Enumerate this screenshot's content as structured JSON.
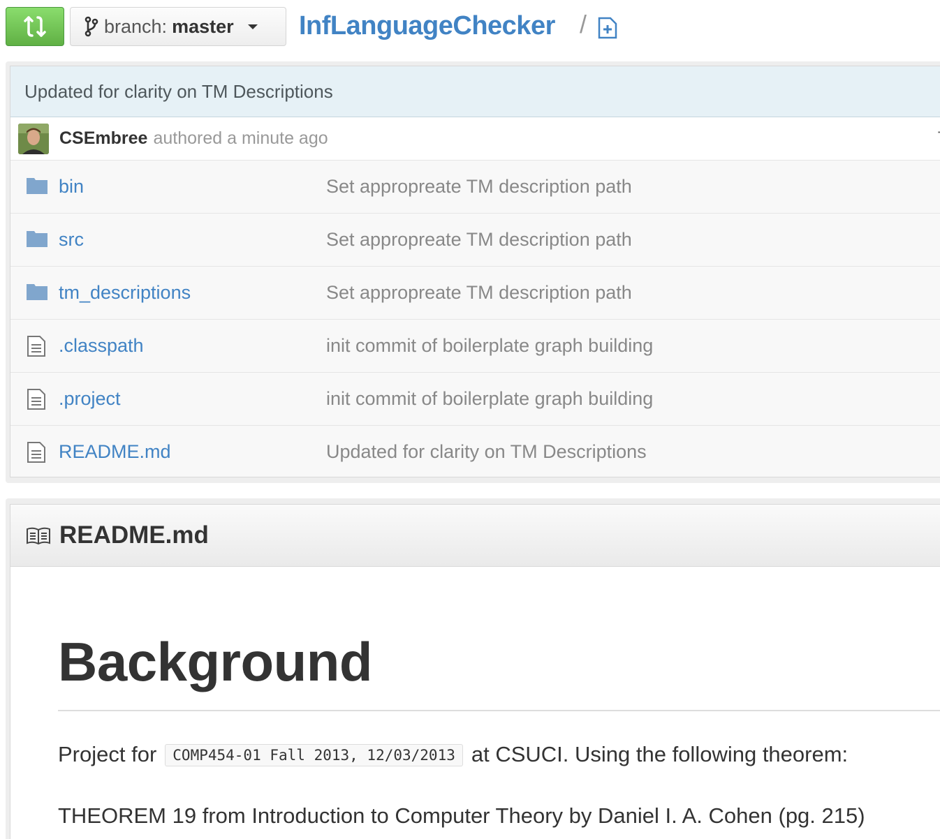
{
  "topbar": {
    "compare_icon": "compare-arrows-icon",
    "branch_label": "branch:",
    "branch_name": "master",
    "repo_name": "InfLanguageChecker",
    "path_separator": "/"
  },
  "latest_commit": {
    "message": "Updated for clarity on TM Descriptions",
    "author": "CSEmbree",
    "time_text": "authored a minute ago",
    "sha_fragment": "T"
  },
  "files": [
    {
      "type": "folder",
      "name": "bin",
      "message": "Set appropreate TM description path"
    },
    {
      "type": "folder",
      "name": "src",
      "message": "Set appropreate TM description path"
    },
    {
      "type": "folder",
      "name": "tm_descriptions",
      "message": "Set appropreate TM description path"
    },
    {
      "type": "file",
      "name": ".classpath",
      "message": "init commit of boilerplate graph building"
    },
    {
      "type": "file",
      "name": ".project",
      "message": "init commit of boilerplate graph building"
    },
    {
      "type": "file",
      "name": "README.md",
      "message": "Updated for clarity on TM Descriptions"
    }
  ],
  "readme": {
    "filename": "README.md",
    "heading": "Background",
    "p1_before": "Project for",
    "p1_code": "COMP454-01 Fall 2013, 12/03/2013",
    "p1_after": "at CSUCI. Using the following theorem:",
    "p2": "THEOREM 19 from Introduction to Computer Theory by Daniel I. A. Cohen (pg. 215)"
  },
  "colors": {
    "link": "#4183c4",
    "compare_button": "#60b044",
    "commit_bar": "#e6f1f6",
    "folder_icon": "#80a6cd"
  }
}
